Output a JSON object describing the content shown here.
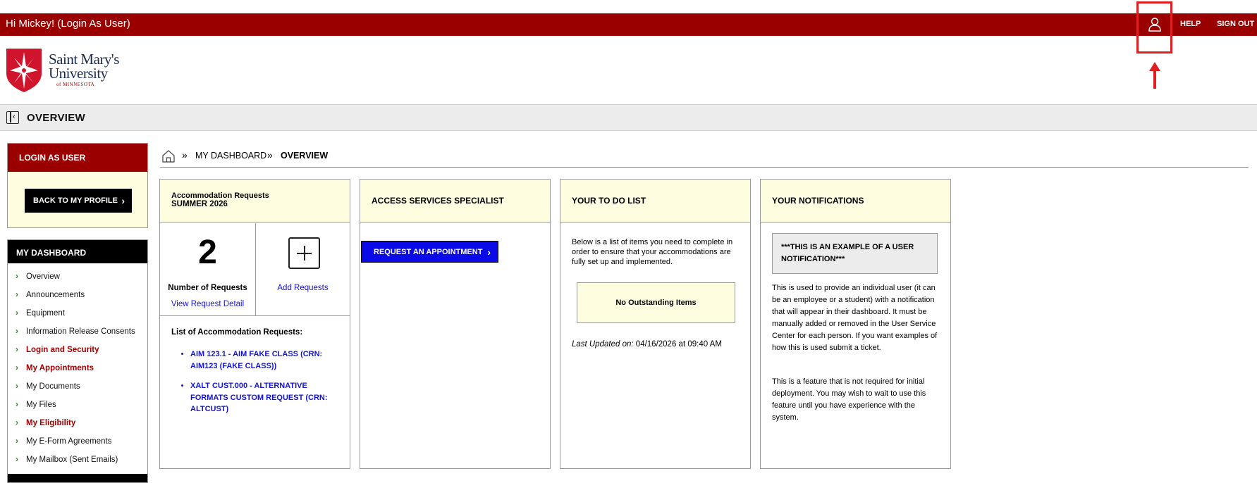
{
  "topbar": {
    "greeting": "Hi Mickey! (Login As User)",
    "help_label": "HELP",
    "signout_label": "SIGN OUT",
    "user_icon": "user-icon"
  },
  "logo": {
    "line1": "Saint Mary's",
    "line2": "University",
    "line3": "of MINNESOTA"
  },
  "page": {
    "title": "OVERVIEW"
  },
  "sidebar": {
    "login_as": {
      "header": "LOGIN AS USER",
      "back_button": "BACK TO MY PROFILE"
    },
    "dashboard": {
      "header": "MY DASHBOARD",
      "items": [
        {
          "label": "Overview",
          "highlight": false
        },
        {
          "label": "Announcements",
          "highlight": false
        },
        {
          "label": "Equipment",
          "highlight": false
        },
        {
          "label": "Information Release Consents",
          "highlight": false
        },
        {
          "label": "Login and Security",
          "highlight": true
        },
        {
          "label": "My Appointments",
          "highlight": true
        },
        {
          "label": "My Documents",
          "highlight": false
        },
        {
          "label": "My Files",
          "highlight": false
        },
        {
          "label": "My Eligibility",
          "highlight": true
        },
        {
          "label": "My E-Form Agreements",
          "highlight": false
        },
        {
          "label": "My Mailbox (Sent Emails)",
          "highlight": false
        }
      ]
    }
  },
  "breadcrumb": {
    "items": [
      "MY DASHBOARD",
      "OVERVIEW"
    ]
  },
  "cards": {
    "accommodation": {
      "title_line1": "Accommodation Requests",
      "title_line2": "SUMMER 2026",
      "count": "2",
      "count_label": "Number of Requests",
      "view_link": "View Request Detail",
      "add_link": "Add Requests",
      "list_title": "List of Accommodation Requests:",
      "requests": [
        "AIM 123.1 - AIM FAKE CLASS (CRN: AIM123 (FAKE CLASS))",
        "XALT CUST.000 - ALTERNATIVE FORMATS CUSTOM REQUEST (CRN: ALTCUST)"
      ]
    },
    "access": {
      "title": "ACCESS SERVICES SPECIALIST",
      "button": "REQUEST AN APPOINTMENT"
    },
    "todo": {
      "title": "YOUR TO DO LIST",
      "description": "Below is a list of items you need to complete in order to ensure that your accommodations are fully set up and implemented.",
      "empty": "No Outstanding Items",
      "updated_label": "Last Updated on:",
      "updated_value": "04/16/2026 at 09:40 AM"
    },
    "notifications": {
      "title": "YOUR NOTIFICATIONS",
      "box": "***THIS IS AN EXAMPLE OF A USER NOTIFICATION***",
      "para1": "This is used to provide an individual user (it can be an employee or a student) with a notification that will appear in their dashboard. It must be manually added or removed in the User Service Center for each person. If you want examples of how this is used submit a ticket.",
      "para2": "This is a feature that is not required for initial deployment. You may wish to wait to use this feature until you have experience with the system."
    }
  },
  "colors": {
    "brand_red": "#9b0000",
    "header_yellow": "#fffde0",
    "link_blue": "#1515d0",
    "button_blue": "#0a0ae8",
    "annotation_red": "#e02020"
  }
}
